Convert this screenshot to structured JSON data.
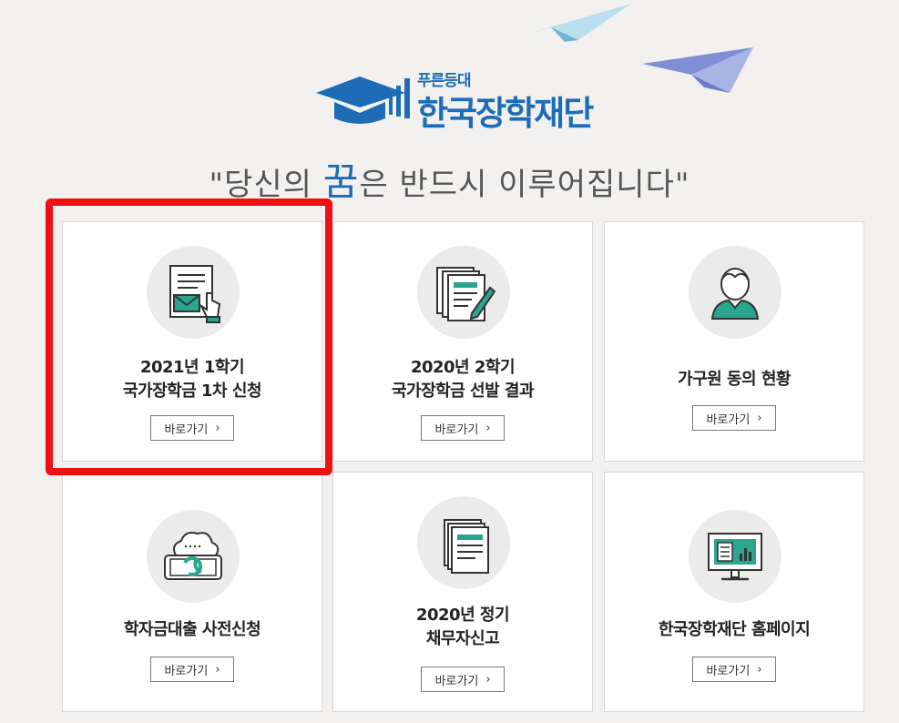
{
  "logo": {
    "sub": "푸른등대",
    "main": "한국장학재단"
  },
  "slogan": {
    "open": "\"당신의 ",
    "emphasis": "꿈",
    "rest": "은 반드시 이루어집니다\""
  },
  "cards": [
    {
      "line1": "2021년 1학기",
      "line2": "국가장학금 1차 신청",
      "button": "바로가기",
      "icon": "application-document-icon"
    },
    {
      "line1": "2020년 2학기",
      "line2": "국가장학금 선발 결과",
      "button": "바로가기",
      "icon": "documents-pen-icon"
    },
    {
      "line1": "가구원 동의 현황",
      "line2": "",
      "button": "바로가기",
      "icon": "person-icon"
    },
    {
      "line1": "학자금대출 사전신청",
      "line2": "",
      "button": "바로가기",
      "icon": "cloud-sync-icon"
    },
    {
      "line1": "2020년 정기",
      "line2": "채무자신고",
      "button": "바로가기",
      "icon": "document-stack-icon"
    },
    {
      "line1": "한국장학재단 홈페이지",
      "line2": "",
      "button": "바로가기",
      "icon": "monitor-icon"
    }
  ],
  "colors": {
    "brand": "#1d6cb7",
    "teal": "#2ba58f",
    "highlight": "#ee1111"
  }
}
